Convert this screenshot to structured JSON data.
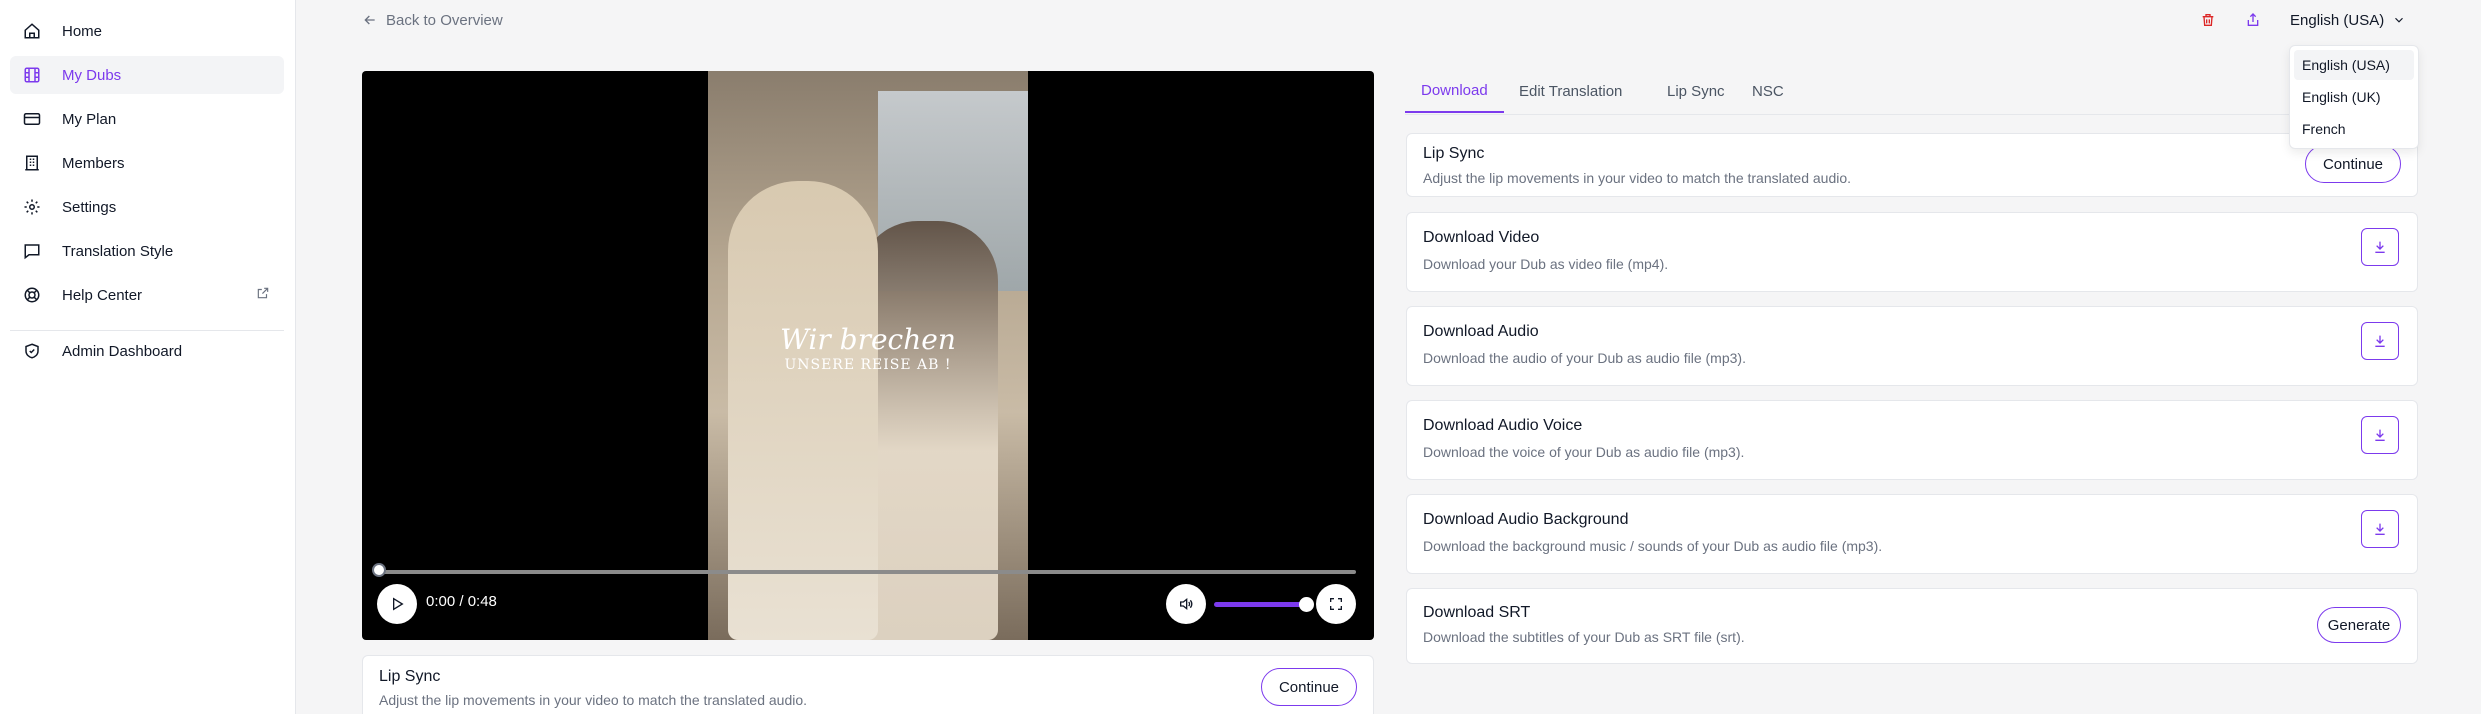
{
  "sidebar": {
    "items": [
      {
        "label": "Home",
        "icon": "home-icon"
      },
      {
        "label": "My Dubs",
        "icon": "film-icon",
        "active": true
      },
      {
        "label": "My Plan",
        "icon": "credit-card-icon"
      },
      {
        "label": "Members",
        "icon": "building-icon"
      },
      {
        "label": "Settings",
        "icon": "gear-icon"
      },
      {
        "label": "Translation Style",
        "icon": "chat-icon"
      },
      {
        "label": "Help Center",
        "icon": "lifebuoy-icon"
      }
    ],
    "admin": {
      "label": "Admin Dashboard",
      "icon": "shield-icon"
    }
  },
  "header": {
    "back_label": "Back to Overview",
    "language": "English (USA)"
  },
  "language_menu": {
    "options": [
      "English (USA)",
      "English (UK)",
      "French"
    ],
    "selected": "English (USA)"
  },
  "video": {
    "caption_line1": "Wir brechen",
    "caption_line2": "UNSERE REISE AB !",
    "time": "0:00 / 0:48",
    "progress_fraction": 0,
    "volume_fraction": 1
  },
  "lip_sync_bottom": {
    "title": "Lip Sync",
    "description": "Adjust the lip movements in your video to match the translated audio.",
    "button": "Continue"
  },
  "tabs": [
    "Download",
    "Edit Translation",
    "Lip Sync",
    "NSC"
  ],
  "active_tab": "Download",
  "cards": {
    "lip_sync": {
      "title": "Lip Sync",
      "description": "Adjust the lip movements in your video to match the translated audio.",
      "button": "Continue"
    },
    "video": {
      "title": "Download Video",
      "description": "Download your Dub as video file (mp4)."
    },
    "audio": {
      "title": "Download Audio",
      "description": "Download the audio of your Dub as audio file (mp3)."
    },
    "voice": {
      "title": "Download Audio Voice",
      "description": "Download the voice of your Dub as audio file (mp3)."
    },
    "background": {
      "title": "Download Audio Background",
      "description": "Download the background music / sounds of your Dub as audio file (mp3)."
    },
    "srt": {
      "title": "Download SRT",
      "description": "Download the subtitles of your Dub as SRT file (srt).",
      "button": "Generate"
    }
  },
  "colors": {
    "accent": "#7c3aed",
    "danger": "#dc2626"
  }
}
